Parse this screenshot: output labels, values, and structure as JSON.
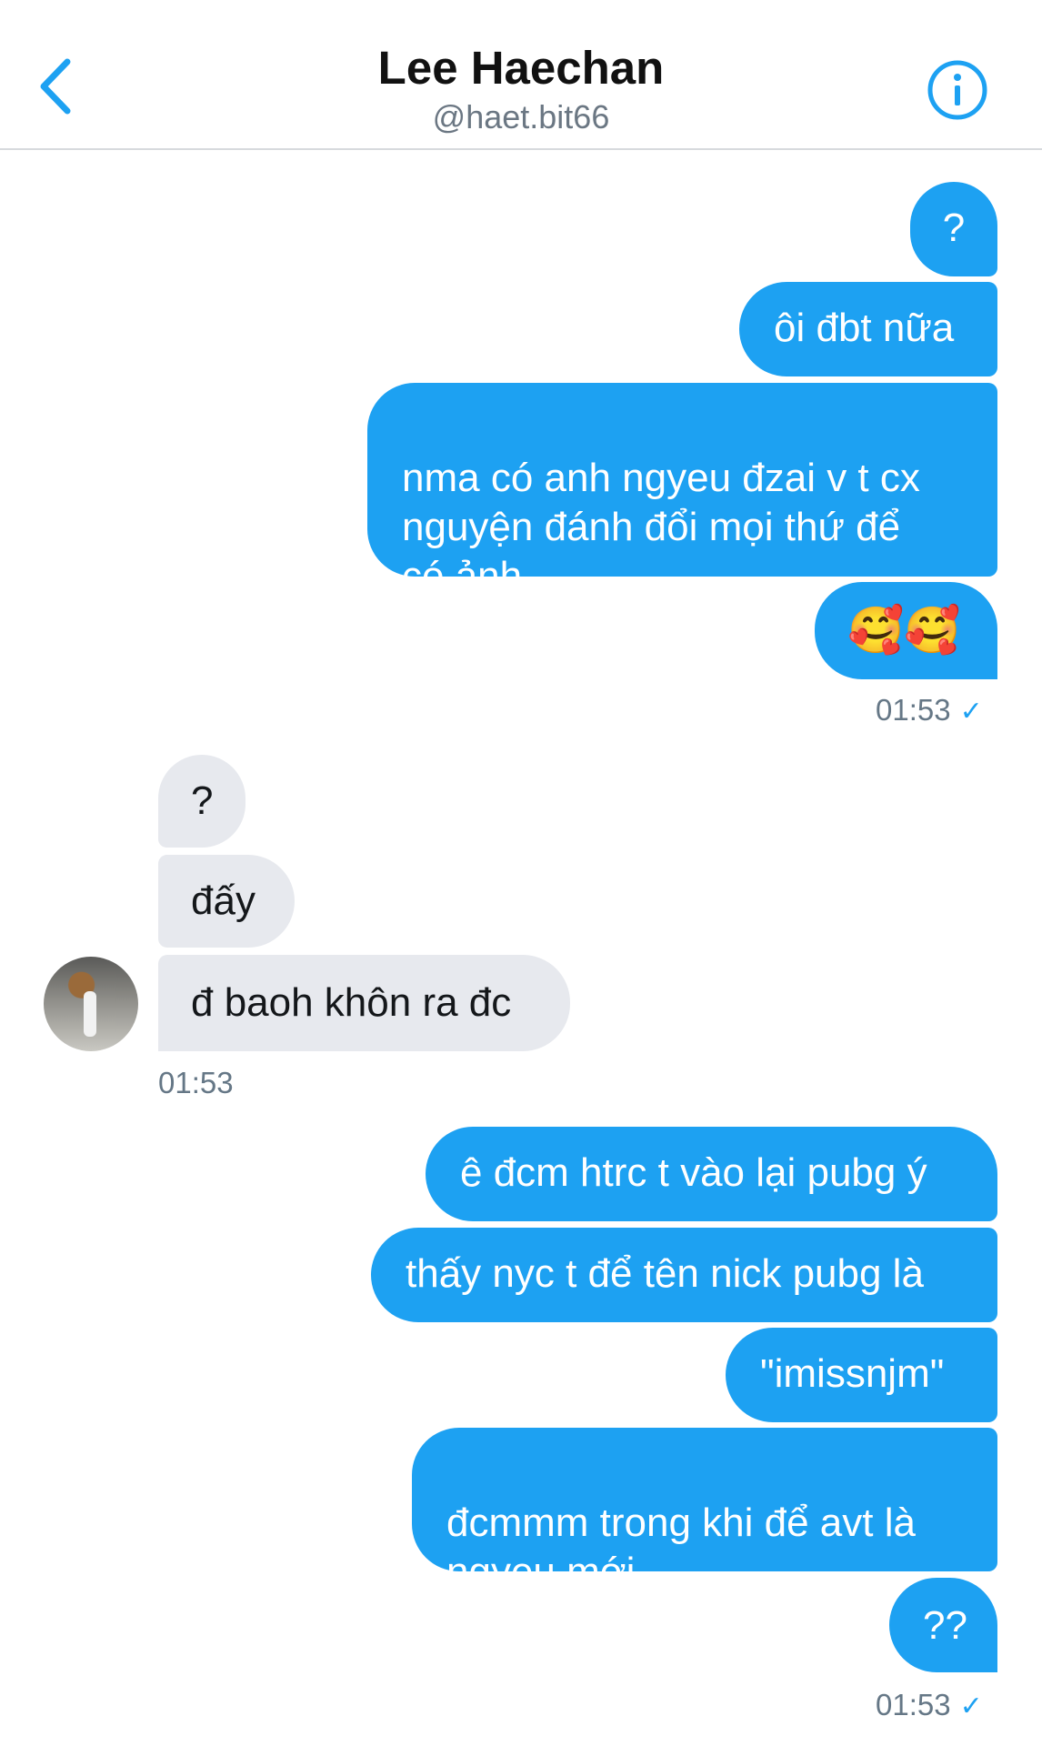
{
  "header": {
    "title": "Lee Haechan",
    "handle": "@haet.bit66"
  },
  "icons": {
    "back": "chevron-left-icon",
    "info": "info-icon",
    "read_receipt": "check-icon"
  },
  "colors": {
    "accent": "#1da1f2",
    "incoming_bubble": "#e7e9ee"
  },
  "messages": {
    "group1": [
      "?",
      "ôi đbt nữa",
      "nma có anh ngyeu đzai v t cx\nnguyện đánh đổi mọi thứ để\ncó ảnh",
      "🥰🥰"
    ],
    "group1_time": "01:53",
    "group2": [
      "?",
      "đấy",
      "đ baoh khôn ra đc"
    ],
    "group2_time": "01:53",
    "group3": [
      "ê đcm htrc t vào lại pubg ý",
      "thấy nyc t để tên nick pubg là",
      "\"imissnjm\"",
      "đcmmm trong khi để avt là\nngyeu mới",
      "??"
    ],
    "group3_time": "01:53"
  },
  "receipt_mark": "✓"
}
